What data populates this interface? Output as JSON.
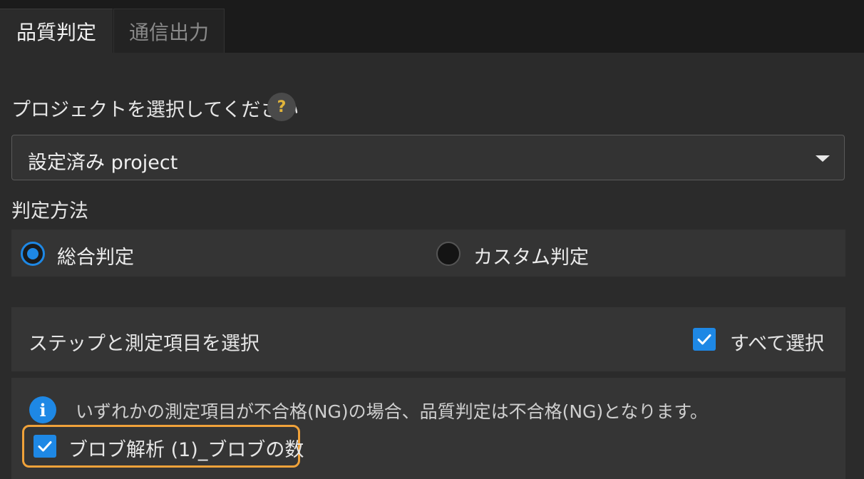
{
  "tabs": [
    {
      "label": "品質判定",
      "active": true
    },
    {
      "label": "通信出力",
      "active": false
    }
  ],
  "project": {
    "label": "プロジェクトを選択してください",
    "help_icon": "?",
    "selected": "設定済み project"
  },
  "method": {
    "label": "判定方法",
    "options": [
      {
        "label": "総合判定",
        "selected": true
      },
      {
        "label": "カスタム判定",
        "selected": false
      }
    ]
  },
  "steps": {
    "title": "ステップと測定項目を選択",
    "select_all_label": "すべて選択",
    "select_all_checked": true,
    "info_icon": "i",
    "info_text": "いずれかの測定項目が不合格(NG)の場合、品質判定は不合格(NG)となります。",
    "items": [
      {
        "label": "ブロブ解析 (1)_ブロブの数",
        "checked": true
      }
    ]
  },
  "colors": {
    "accent": "#1e88e5",
    "highlight": "#f0a23a",
    "background": "#2b2b2b",
    "tabbar": "#1b1b1b"
  }
}
